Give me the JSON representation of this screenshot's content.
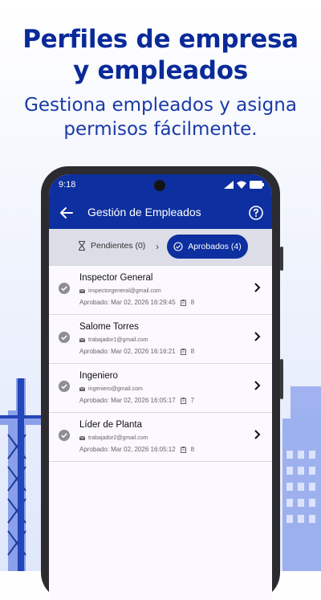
{
  "hero": {
    "title_line1": "Perfiles de empresa",
    "title_line2": "y empleados",
    "subtitle_line1": "Gestiona empleados y asigna",
    "subtitle_line2": "permisos fácilmente."
  },
  "status_bar": {
    "time": "9:18"
  },
  "app_bar": {
    "title": "Gestión de Empleados",
    "back_icon": "arrow-left-icon",
    "help_icon": "help-circle-icon"
  },
  "tabs": [
    {
      "label": "Pendientes (0)",
      "icon": "hourglass-icon",
      "selected": false
    },
    {
      "label": "Aprobados (4)",
      "icon": "check-circle-icon",
      "selected": true
    }
  ],
  "employees": [
    {
      "name": "Inspector General",
      "email": "inspectorgeneral@gmail.com",
      "approved": "Aprobado: Mar 02, 2026 16:29:45",
      "count": "8"
    },
    {
      "name": "Salome Torres",
      "email": "trabajador1@gmail.com",
      "approved": "Aprobado: Mar 02, 2026 16:16:21",
      "count": "8"
    },
    {
      "name": "Ingeniero",
      "email": "ingeniero@gmail.com",
      "approved": "Aprobado: Mar 02, 2026 16:05:17",
      "count": "7"
    },
    {
      "name": "Líder de Planta",
      "email": "trabajador2@gmail.com",
      "approved": "Aprobado: Mar 02, 2026 16:05:12",
      "count": "8"
    }
  ],
  "colors": {
    "primary": "#0d2f9f",
    "hero_text": "#0a2a99",
    "tab_bar": "#dcdde6",
    "list_bg": "#fbf8ff"
  }
}
